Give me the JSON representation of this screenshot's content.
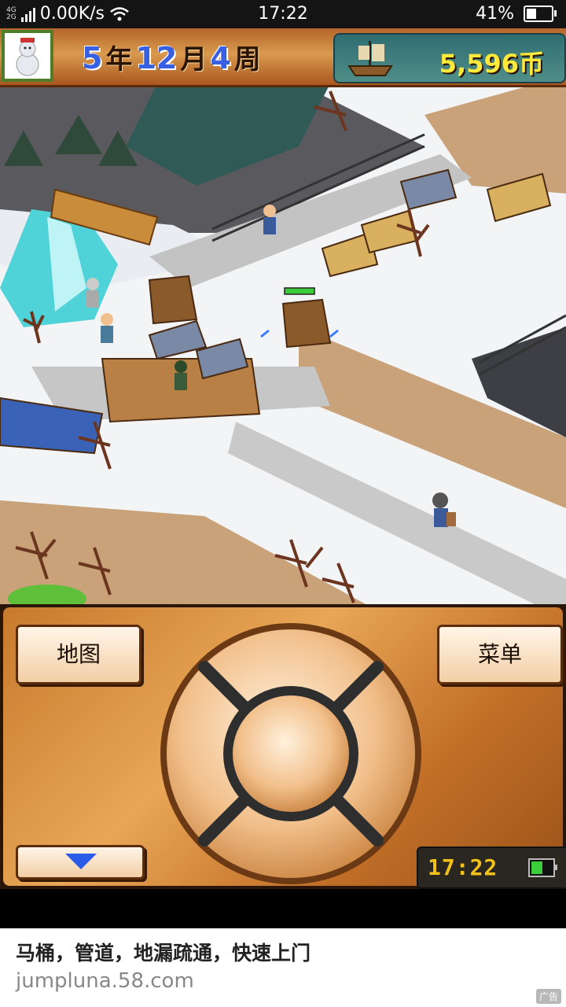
{
  "status_bar": {
    "network": "4G\n2G",
    "speed": "0.00K/s",
    "time": "17:22",
    "battery": "41%"
  },
  "hud": {
    "year_num": "5",
    "year_unit": "年",
    "month_num": "12",
    "month_unit": "月",
    "week_num": "4",
    "week_unit": "周",
    "money": "5,596币"
  },
  "controls": {
    "map_label": "地图",
    "menu_label": "菜单",
    "clock": "17:22"
  },
  "ad": {
    "title": "马桶，管道，地漏疏通，快速上门",
    "url": "jumpluna.58.com",
    "tag": "广告"
  },
  "colors": {
    "accent_blue": "#3960e0",
    "money_yellow": "#ffe93a",
    "panel_brown": "#c77a2c",
    "snow": "#f2f4f6"
  }
}
